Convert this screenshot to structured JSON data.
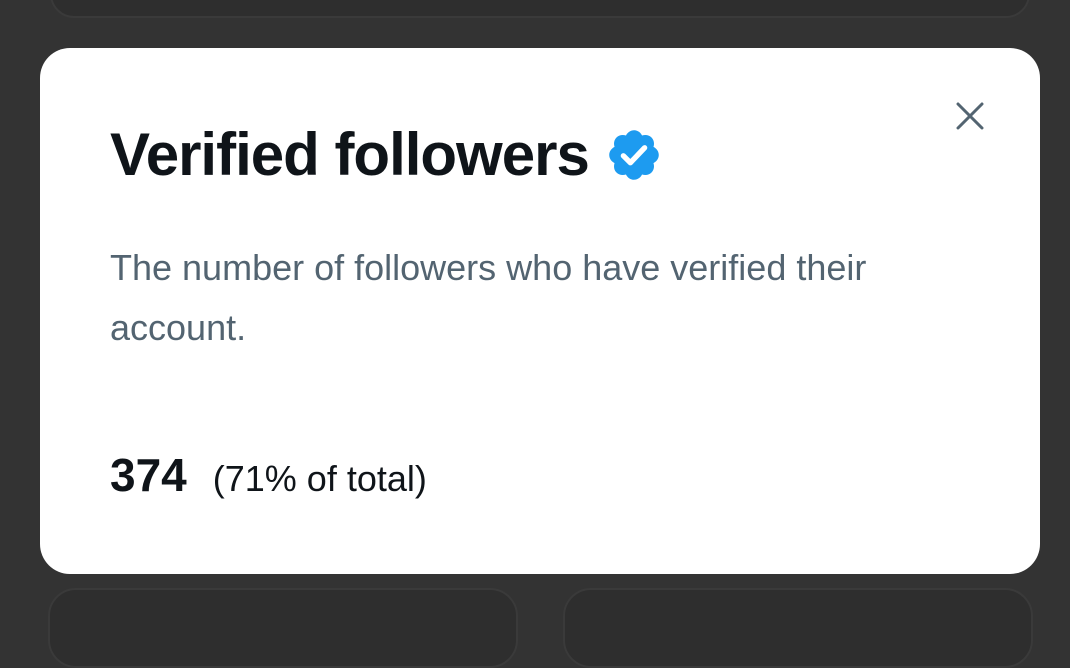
{
  "modal": {
    "title": "Verified followers",
    "description": "The number of followers who have verified their account.",
    "count": "374",
    "percent": "(71% of total)"
  },
  "icons": {
    "close": "close-icon",
    "verified": "verified-badge-icon"
  },
  "colors": {
    "backdrop": "#333333",
    "modal_bg": "#ffffff",
    "title": "#0f1419",
    "description": "#536471",
    "badge_blue": "#1d9bf0",
    "close_icon": "#536471"
  }
}
